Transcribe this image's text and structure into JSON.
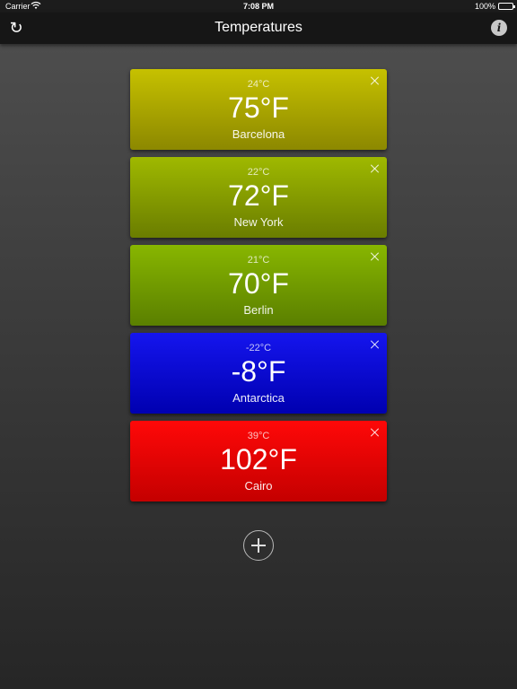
{
  "status_bar": {
    "carrier": "Carrier",
    "time": "7:08 PM",
    "battery": "100%"
  },
  "nav": {
    "title": "Temperatures",
    "refresh_icon": "↻",
    "info_icon": "i"
  },
  "cities": [
    {
      "celsius": "24°C",
      "fahrenheit": "75°F",
      "name": "Barcelona",
      "color_top": "#c6c100",
      "color_bottom": "#8c8800"
    },
    {
      "celsius": "22°C",
      "fahrenheit": "72°F",
      "name": "New York",
      "color_top": "#9fb900",
      "color_bottom": "#6a7d00"
    },
    {
      "celsius": "21°C",
      "fahrenheit": "70°F",
      "name": "Berlin",
      "color_top": "#88b600",
      "color_bottom": "#5a7f00"
    },
    {
      "celsius": "-22°C",
      "fahrenheit": "-8°F",
      "name": "Antarctica",
      "color_top": "#1515ee",
      "color_bottom": "#0000b0"
    },
    {
      "celsius": "39°C",
      "fahrenheit": "102°F",
      "name": "Cairo",
      "color_top": "#ff0808",
      "color_bottom": "#c40000"
    }
  ]
}
